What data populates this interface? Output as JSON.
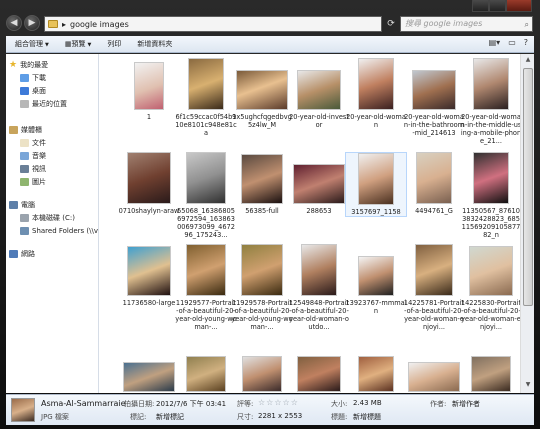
{
  "address": {
    "path": "google images"
  },
  "search": {
    "placeholder": "搜尋 google images"
  },
  "toolbar": {
    "organize": "組合管理",
    "preview": "預覽",
    "print": "列印",
    "new_folder": "新增資料夾"
  },
  "sidebar": {
    "favorites": "我的最愛",
    "downloads": "下載",
    "desktop": "桌面",
    "recent": "最近的位置",
    "libraries": "媒體櫃",
    "documents": "文件",
    "music": "音樂",
    "videos": "視訊",
    "pictures": "圖片",
    "computer": "電腦",
    "local_disk": "本機磁碟 (C:)",
    "shared_folders": "Shared Folders (\\\\v",
    "network": "網路"
  },
  "files": [
    {
      "name": "1"
    },
    {
      "name": "6f1c59ccac0f54b110e8101c948e81ca"
    },
    {
      "name": "9x5ughcfqgedbvg5z4lw_M"
    },
    {
      "name": "20-year-old-investor"
    },
    {
      "name": "20-year-old-woman"
    },
    {
      "name": "20-year-old-woman-in-the-bathroom-mid_214613"
    },
    {
      "name": "20-year-old-woman-in-the-middle-using-a-mobile-phone_21..."
    },
    {
      "name": "0710shaylyn-araw"
    },
    {
      "name": "55068_163868056972594_163863006973099_467296_175243..."
    },
    {
      "name": "56385-full"
    },
    {
      "name": "288653"
    },
    {
      "name": "3157697_1158"
    },
    {
      "name": "4494761_G"
    },
    {
      "name": "11350567_876103832428823_68511569209105877 82_n"
    },
    {
      "name": "11736580-large"
    },
    {
      "name": "11929577-Portrait-of-a-beautiful-20-year-old-young-woman-..."
    },
    {
      "name": "11929578-Portrait-of-a-beautiful-20-year-old-young-woman-..."
    },
    {
      "name": "12549848-Portrait-of-a-beautiful-20-year-old-woman-outdo..."
    },
    {
      "name": "13923767-mmmain"
    },
    {
      "name": "14225781-Portrait-of-a-beautiful-20-year-old-woman-enjoyi..."
    },
    {
      "name": "14225830-Portrait-of-a-beautiful-20-year-old-woman-enjoyi..."
    },
    {
      "name": ""
    },
    {
      "name": ""
    },
    {
      "name": ""
    },
    {
      "name": ""
    },
    {
      "name": ""
    },
    {
      "name": ""
    },
    {
      "name": ""
    }
  ],
  "details": {
    "filename": "Asma-Al-Sammarraie",
    "filetype": "JPG 檔案",
    "date_taken_label": "拍攝日期:",
    "date_taken": "2012/7/6 下午 03:41",
    "tags_label": "標記:",
    "tags": "新增標記",
    "rating_label": "評等:",
    "dimensions_label": "尺寸:",
    "dimensions": "2281 x 2553",
    "size_label": "大小:",
    "size": "2.43 MB",
    "title_label": "標題:",
    "title": "新增標題",
    "author_label": "作者:",
    "author": "新增作者"
  },
  "colors": {
    "accent": "#3f74c4",
    "selection": "#cde4fc"
  }
}
